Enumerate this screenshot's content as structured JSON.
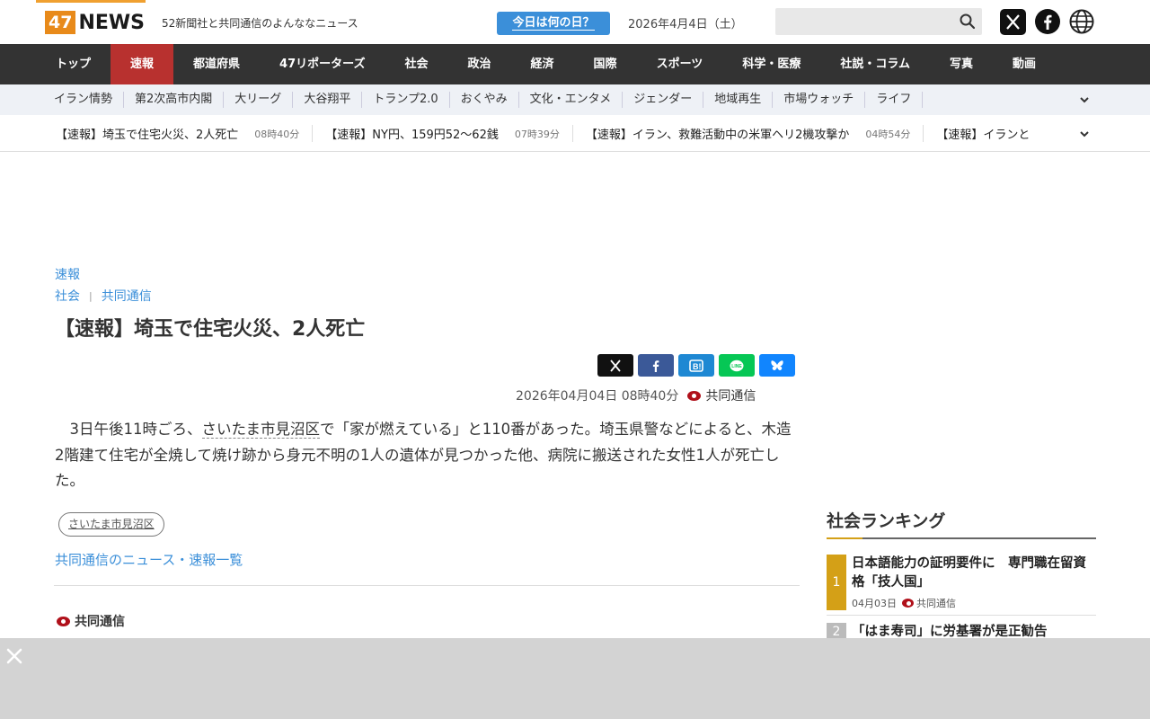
{
  "header": {
    "logo_num": "47",
    "logo_text": "NEWS",
    "tagline": "52新聞社と共同通信のよんななニュース",
    "today_button": "今日は何の日？",
    "date": "2026年4月4日（土）",
    "search_placeholder": ""
  },
  "mainnav": [
    "トップ",
    "速報",
    "都道府県",
    "47リポーターズ",
    "社会",
    "政治",
    "経済",
    "国際",
    "スポーツ",
    "科学・医療",
    "社説・コラム",
    "写真",
    "動画"
  ],
  "mainnav_active": "速報",
  "subnav": [
    "イラン情勢",
    "第2次高市内閣",
    "大リーグ",
    "大谷翔平",
    "トランプ2.0",
    "おくやみ",
    "文化・エンタメ",
    "ジェンダー",
    "地域再生",
    "市場ウォッチ",
    "ライフ"
  ],
  "ticker": [
    {
      "title": "【速報】埼玉で住宅火災、2人死亡",
      "time": "08時40分"
    },
    {
      "title": "【速報】NY円、159円52〜62銭",
      "time": "07時39分"
    },
    {
      "title": "【速報】イラン、救難活動中の米軍ヘリ2機攻撃か",
      "time": "04時54分"
    },
    {
      "title": "【速報】イランと",
      "time": ""
    }
  ],
  "article": {
    "category": "速報",
    "section": "社会",
    "source_link": "共同通信",
    "headline": "【速報】埼玉で住宅火災、2人死亡",
    "datetime": "2026年04月04日 08時40分",
    "source": "共同通信",
    "body_before": "　3日午後11時ごろ、",
    "body_location": "さいたま市見沼区",
    "body_after": "で「家が燃えている」と110番があった。埼玉県警などによると、木造2階建て住宅が全焼して焼け跡から身元不明の1人の遺体が見つかった他、病院に搬送された女性1人が死亡した。",
    "tag": "さいたま市見沼区",
    "more_link": "共同通信のニュース・速報一覧",
    "footer_source": "共同通信"
  },
  "ranking": {
    "title": "社会ランキング",
    "items": [
      {
        "rank": "1",
        "title": "日本語能力の証明要件に　専門職在留資格「技人国」",
        "date": "04月03日",
        "source": "共同通信"
      },
      {
        "rank": "2",
        "title": "「はま寿司」に労基署が是正勧告",
        "date": "",
        "source": ""
      }
    ]
  },
  "colors": {
    "accent_blue": "#3b8fd9",
    "nav_dark": "#333333",
    "nav_active": "#b8312f",
    "logo_orange": "#e88a1a",
    "rank1": "#d4a017",
    "rank2": "#bbbbbb"
  }
}
